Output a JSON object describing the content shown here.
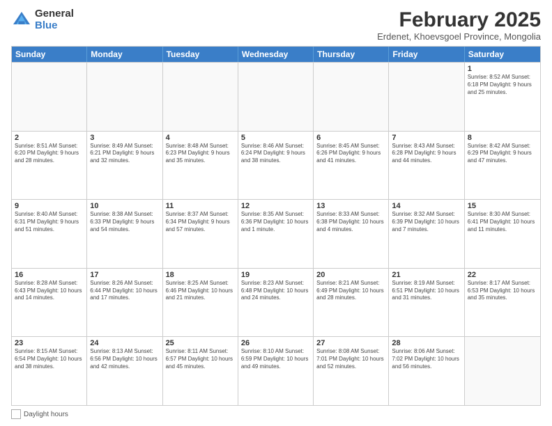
{
  "logo": {
    "general": "General",
    "blue": "Blue"
  },
  "title": "February 2025",
  "subtitle": "Erdenet, Khoevsgoel Province, Mongolia",
  "days_header": [
    "Sunday",
    "Monday",
    "Tuesday",
    "Wednesday",
    "Thursday",
    "Friday",
    "Saturday"
  ],
  "weeks": [
    [
      {
        "day": "",
        "info": ""
      },
      {
        "day": "",
        "info": ""
      },
      {
        "day": "",
        "info": ""
      },
      {
        "day": "",
        "info": ""
      },
      {
        "day": "",
        "info": ""
      },
      {
        "day": "",
        "info": ""
      },
      {
        "day": "1",
        "info": "Sunrise: 8:52 AM\nSunset: 6:18 PM\nDaylight: 9 hours and 25 minutes."
      }
    ],
    [
      {
        "day": "2",
        "info": "Sunrise: 8:51 AM\nSunset: 6:20 PM\nDaylight: 9 hours and 28 minutes."
      },
      {
        "day": "3",
        "info": "Sunrise: 8:49 AM\nSunset: 6:21 PM\nDaylight: 9 hours and 32 minutes."
      },
      {
        "day": "4",
        "info": "Sunrise: 8:48 AM\nSunset: 6:23 PM\nDaylight: 9 hours and 35 minutes."
      },
      {
        "day": "5",
        "info": "Sunrise: 8:46 AM\nSunset: 6:24 PM\nDaylight: 9 hours and 38 minutes."
      },
      {
        "day": "6",
        "info": "Sunrise: 8:45 AM\nSunset: 6:26 PM\nDaylight: 9 hours and 41 minutes."
      },
      {
        "day": "7",
        "info": "Sunrise: 8:43 AM\nSunset: 6:28 PM\nDaylight: 9 hours and 44 minutes."
      },
      {
        "day": "8",
        "info": "Sunrise: 8:42 AM\nSunset: 6:29 PM\nDaylight: 9 hours and 47 minutes."
      }
    ],
    [
      {
        "day": "9",
        "info": "Sunrise: 8:40 AM\nSunset: 6:31 PM\nDaylight: 9 hours and 51 minutes."
      },
      {
        "day": "10",
        "info": "Sunrise: 8:38 AM\nSunset: 6:33 PM\nDaylight: 9 hours and 54 minutes."
      },
      {
        "day": "11",
        "info": "Sunrise: 8:37 AM\nSunset: 6:34 PM\nDaylight: 9 hours and 57 minutes."
      },
      {
        "day": "12",
        "info": "Sunrise: 8:35 AM\nSunset: 6:36 PM\nDaylight: 10 hours and 1 minute."
      },
      {
        "day": "13",
        "info": "Sunrise: 8:33 AM\nSunset: 6:38 PM\nDaylight: 10 hours and 4 minutes."
      },
      {
        "day": "14",
        "info": "Sunrise: 8:32 AM\nSunset: 6:39 PM\nDaylight: 10 hours and 7 minutes."
      },
      {
        "day": "15",
        "info": "Sunrise: 8:30 AM\nSunset: 6:41 PM\nDaylight: 10 hours and 11 minutes."
      }
    ],
    [
      {
        "day": "16",
        "info": "Sunrise: 8:28 AM\nSunset: 6:43 PM\nDaylight: 10 hours and 14 minutes."
      },
      {
        "day": "17",
        "info": "Sunrise: 8:26 AM\nSunset: 6:44 PM\nDaylight: 10 hours and 17 minutes."
      },
      {
        "day": "18",
        "info": "Sunrise: 8:25 AM\nSunset: 6:46 PM\nDaylight: 10 hours and 21 minutes."
      },
      {
        "day": "19",
        "info": "Sunrise: 8:23 AM\nSunset: 6:48 PM\nDaylight: 10 hours and 24 minutes."
      },
      {
        "day": "20",
        "info": "Sunrise: 8:21 AM\nSunset: 6:49 PM\nDaylight: 10 hours and 28 minutes."
      },
      {
        "day": "21",
        "info": "Sunrise: 8:19 AM\nSunset: 6:51 PM\nDaylight: 10 hours and 31 minutes."
      },
      {
        "day": "22",
        "info": "Sunrise: 8:17 AM\nSunset: 6:53 PM\nDaylight: 10 hours and 35 minutes."
      }
    ],
    [
      {
        "day": "23",
        "info": "Sunrise: 8:15 AM\nSunset: 6:54 PM\nDaylight: 10 hours and 38 minutes."
      },
      {
        "day": "24",
        "info": "Sunrise: 8:13 AM\nSunset: 6:56 PM\nDaylight: 10 hours and 42 minutes."
      },
      {
        "day": "25",
        "info": "Sunrise: 8:11 AM\nSunset: 6:57 PM\nDaylight: 10 hours and 45 minutes."
      },
      {
        "day": "26",
        "info": "Sunrise: 8:10 AM\nSunset: 6:59 PM\nDaylight: 10 hours and 49 minutes."
      },
      {
        "day": "27",
        "info": "Sunrise: 8:08 AM\nSunset: 7:01 PM\nDaylight: 10 hours and 52 minutes."
      },
      {
        "day": "28",
        "info": "Sunrise: 8:06 AM\nSunset: 7:02 PM\nDaylight: 10 hours and 56 minutes."
      },
      {
        "day": "",
        "info": ""
      }
    ]
  ],
  "footer": {
    "daylight_label": "Daylight hours"
  }
}
